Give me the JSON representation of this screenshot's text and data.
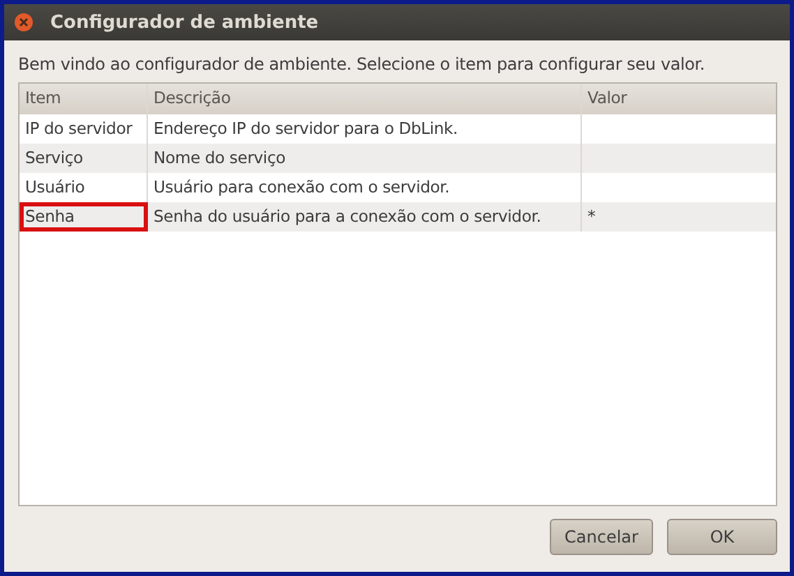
{
  "window": {
    "title": "Configurador de ambiente"
  },
  "intro": "Bem vindo ao configurador de ambiente. Selecione o item para configurar seu valor.",
  "table": {
    "columns": [
      "Item",
      "Descrição",
      "Valor"
    ],
    "rows": [
      {
        "item": "IP do servidor",
        "description": "Endereço IP do servidor para o DbLink.",
        "value": null,
        "highlighted": false
      },
      {
        "item": "Serviço",
        "description": "Nome do serviço",
        "value": null,
        "highlighted": false
      },
      {
        "item": "Usuário",
        "description": "Usuário para conexão com o servidor.",
        "value": null,
        "highlighted": false
      },
      {
        "item": "Senha",
        "description": "Senha do usuário para a conexão com o servidor.",
        "value": "*",
        "highlighted": true
      }
    ]
  },
  "buttons": [
    "Cancelar",
    "OK"
  ]
}
